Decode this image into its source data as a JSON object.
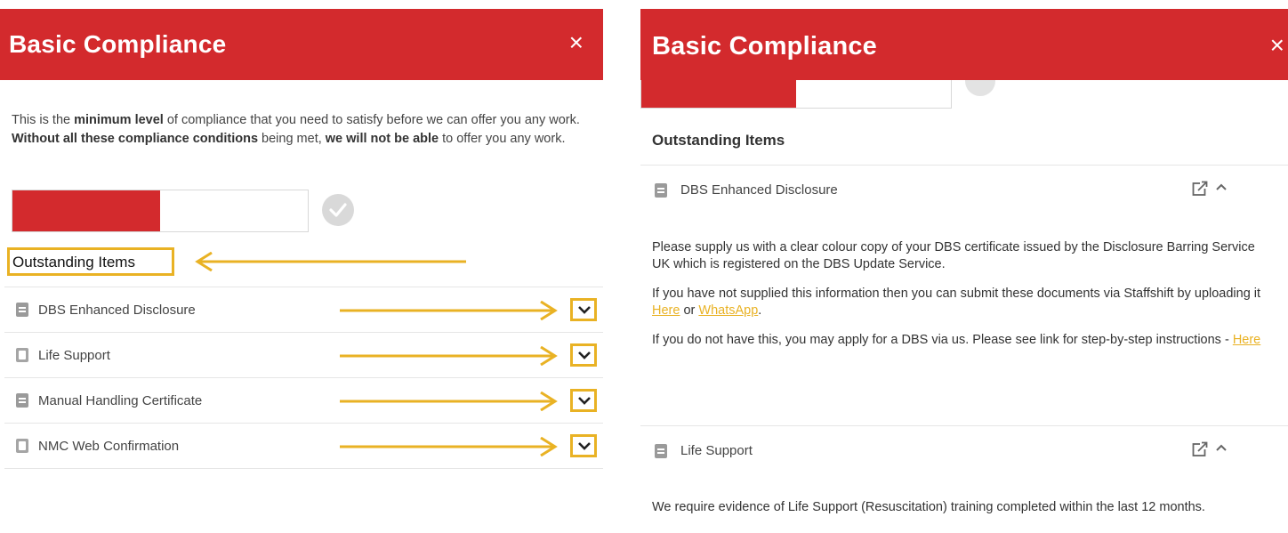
{
  "left_panel": {
    "title": "Basic Compliance",
    "close_icon": "×",
    "intro": {
      "p1": "This is the ",
      "b1": "minimum level",
      "p2": " of compliance that you need to satisfy before we can offer you any work. ",
      "b2": "Without all these compliance conditions",
      "p3": " being met, ",
      "b3": "we will not be able",
      "p4": " to offer you any work."
    },
    "progress_fraction": 0.5,
    "outstanding_heading": "Outstanding Items",
    "items": [
      {
        "label": "DBS Enhanced Disclosure",
        "icon": "document-icon"
      },
      {
        "label": "Life Support",
        "icon": "blank-document-icon"
      },
      {
        "label": "Manual Handling Certificate",
        "icon": "document-icon"
      },
      {
        "label": "NMC Web Confirmation",
        "icon": "blank-document-icon"
      }
    ]
  },
  "right_panel": {
    "title": "Basic Compliance",
    "close_icon": "×",
    "progress_fraction": 0.5,
    "outstanding_heading": "Outstanding Items",
    "dbs": {
      "label": "DBS Enhanced Disclosure",
      "para1": "Please supply us with a clear colour copy of your DBS certificate issued by the Disclosure Barring Service UK which is registered on the DBS Update Service.",
      "para2_a": "If you have not supplied this information then you can submit these documents via Staffshift by uploading it ",
      "para2_link1": "Here",
      "para2_b": " or ",
      "para2_link2": "WhatsApp",
      "para2_c": ".",
      "para3_a": "If you do not have this, you may apply for a DBS via us. Please see link for step-by-step instructions - ",
      "para3_link": "Here"
    },
    "life_support": {
      "label": "Life Support",
      "para1": "We require evidence of Life Support (Resuscitation) training completed within the last 12 months."
    }
  },
  "colors": {
    "header_red": "#d32a2d",
    "highlight_yellow": "#e9b224",
    "link_yellow": "#e9b224"
  }
}
